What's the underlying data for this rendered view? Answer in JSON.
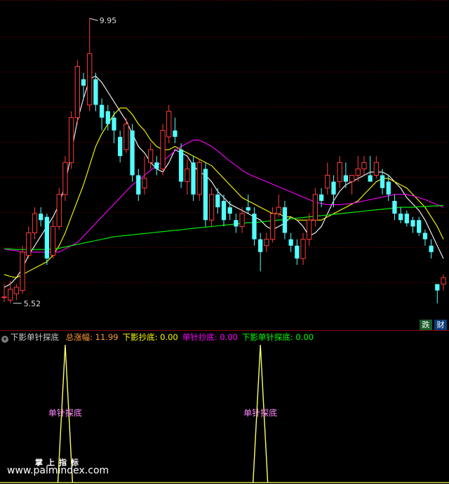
{
  "header": {
    "indicator_name": "下影单针探底",
    "items": [
      {
        "label": "总涨幅:",
        "value": "11.99",
        "color": "#ff9933"
      },
      {
        "label": "下影抄底:",
        "value": "0.00",
        "color": "#ffff00"
      },
      {
        "label": "单针抄底:",
        "value": "0.00",
        "color": "#ff00ff"
      },
      {
        "label": "下影单针探底:",
        "value": "0.00",
        "color": "#00ff00"
      }
    ]
  },
  "tags": {
    "fall": "跌",
    "finance": "财"
  },
  "watermark": {
    "cn": "掌上指标",
    "url": "www.palmindex.com"
  },
  "colors": {
    "up": "#ff3c3c",
    "down": "#54ffff",
    "ma5": "#ffffff",
    "ma10": "#ffff00",
    "ma20": "#ff00ff",
    "ma60": "#00ff00",
    "grid": "#8b0000"
  },
  "chart_data": [
    {
      "type": "candlestick",
      "annotations": {
        "high": "9.95",
        "low": "5.52"
      },
      "ylim": [
        5.3,
        10.15
      ],
      "x_count": 73,
      "candles": [
        [
          5.6,
          5.6,
          5.8,
          5.52
        ],
        [
          5.55,
          5.72,
          5.85,
          5.5
        ],
        [
          5.65,
          5.75,
          5.8,
          5.55
        ],
        [
          5.7,
          6.3,
          6.4,
          5.65
        ],
        [
          6.25,
          6.6,
          6.7,
          6.2
        ],
        [
          6.6,
          6.9,
          7.0,
          6.5
        ],
        [
          6.9,
          6.8,
          7.0,
          6.7
        ],
        [
          6.85,
          6.2,
          6.9,
          6.1
        ],
        [
          6.25,
          6.7,
          6.8,
          6.2
        ],
        [
          6.7,
          7.2,
          7.3,
          6.65
        ],
        [
          7.2,
          7.7,
          7.8,
          7.1
        ],
        [
          7.7,
          8.4,
          8.5,
          7.6
        ],
        [
          8.4,
          9.2,
          9.3,
          8.3
        ],
        [
          9.0,
          8.9,
          9.1,
          8.7
        ],
        [
          8.6,
          9.4,
          9.95,
          8.5
        ],
        [
          9.0,
          8.6,
          9.1,
          8.5
        ],
        [
          8.6,
          8.4,
          8.7,
          8.2
        ],
        [
          8.5,
          8.3,
          8.6,
          8.2
        ],
        [
          8.4,
          8.2,
          8.5,
          8.0
        ],
        [
          8.1,
          7.8,
          8.2,
          7.7
        ],
        [
          7.9,
          8.3,
          8.4,
          7.85
        ],
        [
          8.2,
          7.5,
          8.3,
          7.4
        ],
        [
          7.5,
          7.2,
          7.6,
          7.1
        ],
        [
          7.3,
          7.45,
          7.8,
          7.2
        ],
        [
          7.7,
          7.9,
          8.0,
          7.6
        ],
        [
          7.7,
          7.6,
          7.8,
          7.5
        ],
        [
          7.6,
          8.2,
          8.3,
          7.5
        ],
        [
          8.1,
          8.5,
          8.6,
          8.0
        ],
        [
          8.2,
          8.1,
          8.4,
          8.0
        ],
        [
          7.9,
          7.4,
          8.0,
          7.3
        ],
        [
          7.4,
          7.6,
          7.75,
          7.2
        ],
        [
          7.7,
          7.2,
          7.8,
          7.1
        ],
        [
          7.2,
          7.7,
          7.75,
          7.1
        ],
        [
          7.6,
          6.8,
          7.7,
          6.7
        ],
        [
          6.8,
          7.2,
          7.3,
          6.7
        ],
        [
          7.2,
          7.0,
          7.3,
          6.9
        ],
        [
          7.1,
          6.8,
          7.2,
          6.7
        ],
        [
          7.0,
          6.9,
          7.1,
          6.8
        ],
        [
          6.8,
          6.7,
          6.9,
          6.6
        ],
        [
          6.7,
          6.9,
          7.0,
          6.6
        ],
        [
          7.0,
          6.95,
          7.2,
          6.9
        ],
        [
          6.9,
          6.5,
          7.0,
          6.4
        ],
        [
          6.5,
          6.3,
          6.6,
          6.0
        ],
        [
          6.4,
          6.5,
          6.6,
          6.3
        ],
        [
          6.5,
          6.9,
          7.0,
          6.45
        ],
        [
          6.9,
          7.0,
          7.2,
          6.85
        ],
        [
          7.0,
          6.6,
          7.1,
          6.5
        ],
        [
          6.5,
          6.4,
          6.6,
          6.3
        ],
        [
          6.4,
          6.2,
          6.5,
          6.1
        ],
        [
          6.2,
          6.5,
          6.6,
          6.1
        ],
        [
          6.5,
          6.8,
          6.9,
          6.4
        ],
        [
          6.8,
          7.2,
          7.3,
          6.7
        ],
        [
          7.2,
          7.1,
          7.3,
          7.0
        ],
        [
          7.3,
          7.5,
          7.7,
          7.2
        ],
        [
          7.4,
          7.2,
          7.5,
          7.0
        ],
        [
          7.4,
          7.7,
          7.8,
          7.3
        ],
        [
          7.5,
          7.4,
          7.7,
          7.3
        ],
        [
          7.4,
          7.5,
          7.5,
          7.2
        ],
        [
          7.5,
          7.6,
          7.8,
          7.4
        ],
        [
          7.6,
          7.7,
          7.8,
          7.5
        ],
        [
          7.5,
          7.4,
          7.8,
          7.4
        ],
        [
          7.5,
          7.7,
          7.8,
          7.45
        ],
        [
          7.5,
          7.3,
          7.6,
          7.2
        ],
        [
          7.4,
          7.2,
          7.5,
          7.1
        ],
        [
          7.1,
          6.9,
          7.2,
          6.8
        ],
        [
          6.9,
          6.8,
          7.0,
          6.75
        ],
        [
          6.9,
          6.75,
          6.95,
          6.7
        ],
        [
          6.8,
          6.7,
          6.85,
          6.6
        ],
        [
          6.8,
          6.6,
          6.85,
          6.55
        ],
        [
          6.6,
          6.5,
          6.65,
          6.4
        ],
        [
          6.4,
          6.3,
          6.5,
          6.2
        ],
        [
          5.8,
          5.7,
          5.8,
          5.5
        ],
        [
          5.8,
          5.9,
          5.95,
          5.7
        ]
      ],
      "ma": {
        "ma5": [
          5.75,
          5.8,
          5.9,
          6.05,
          6.25,
          6.4,
          6.55,
          6.7,
          6.85,
          7.05,
          7.35,
          7.85,
          8.35,
          8.7,
          9.0,
          9.05,
          8.95,
          8.8,
          8.65,
          8.5,
          8.35,
          8.15,
          7.95,
          7.85,
          7.7,
          7.6,
          7.55,
          7.7,
          7.9,
          7.85,
          7.8,
          7.65,
          7.55,
          7.5,
          7.4,
          7.25,
          7.15,
          7.05,
          7.0,
          6.95,
          6.9,
          6.85,
          6.8,
          6.7,
          6.65,
          6.7,
          6.75,
          6.85,
          6.8,
          6.7,
          6.55,
          6.6,
          6.7,
          6.9,
          7.1,
          7.25,
          7.35,
          7.4,
          7.45,
          7.5,
          7.55,
          7.55,
          7.55,
          7.5,
          7.4,
          7.3,
          7.15,
          7.05,
          6.95,
          6.8,
          6.6,
          6.4,
          6.2
        ],
        "ma10": [
          5.95,
          5.92,
          5.9,
          5.95,
          6.0,
          6.05,
          6.1,
          6.15,
          6.25,
          6.4,
          6.6,
          6.85,
          7.1,
          7.35,
          7.65,
          7.95,
          8.15,
          8.3,
          8.45,
          8.55,
          8.55,
          8.45,
          8.3,
          8.2,
          8.05,
          7.95,
          7.9,
          7.9,
          7.95,
          7.9,
          7.85,
          7.8,
          7.75,
          7.7,
          7.65,
          7.55,
          7.45,
          7.35,
          7.25,
          7.15,
          7.1,
          7.05,
          7.0,
          6.95,
          6.9,
          6.9,
          6.85,
          6.85,
          6.8,
          6.8,
          6.8,
          6.8,
          6.8,
          6.85,
          6.9,
          6.95,
          7.0,
          7.05,
          7.1,
          7.2,
          7.3,
          7.4,
          7.45,
          7.45,
          7.4,
          7.35,
          7.3,
          7.2,
          7.1,
          7.0,
          6.85,
          6.7,
          6.5
        ],
        "ma20": [
          6.35,
          6.33,
          6.32,
          6.3,
          6.3,
          6.3,
          6.3,
          6.3,
          6.3,
          6.3,
          6.35,
          6.4,
          6.45,
          6.55,
          6.65,
          6.75,
          6.85,
          6.95,
          7.05,
          7.15,
          7.25,
          7.35,
          7.42,
          7.5,
          7.58,
          7.65,
          7.72,
          7.8,
          7.88,
          7.95,
          8.0,
          8.05,
          8.05,
          8.0,
          7.95,
          7.88,
          7.8,
          7.72,
          7.65,
          7.58,
          7.52,
          7.48,
          7.44,
          7.4,
          7.36,
          7.32,
          7.28,
          7.24,
          7.2,
          7.16,
          7.12,
          7.08,
          7.06,
          7.04,
          7.04,
          7.04,
          7.05,
          7.06,
          7.08,
          7.1,
          7.12,
          7.14,
          7.16,
          7.18,
          7.2,
          7.2,
          7.2,
          7.18,
          7.15,
          7.12,
          7.08,
          7.04,
          7.0
        ],
        "ma60": [
          6.35,
          6.35,
          6.34,
          6.34,
          6.34,
          6.34,
          6.34,
          6.34,
          6.35,
          6.36,
          6.38,
          6.4,
          6.42,
          6.44,
          6.46,
          6.48,
          6.5,
          6.52,
          6.54,
          6.55,
          6.56,
          6.57,
          6.58,
          6.59,
          6.6,
          6.61,
          6.62,
          6.63,
          6.64,
          6.65,
          6.66,
          6.67,
          6.68,
          6.69,
          6.7,
          6.71,
          6.72,
          6.73,
          6.74,
          6.75,
          6.76,
          6.76,
          6.77,
          6.78,
          6.79,
          6.8,
          6.81,
          6.82,
          6.83,
          6.84,
          6.85,
          6.86,
          6.87,
          6.88,
          6.89,
          6.9,
          6.91,
          6.92,
          6.93,
          6.94,
          6.95,
          6.96,
          6.97,
          6.98,
          6.99,
          7.0,
          7.0,
          7.0,
          7.01,
          7.01,
          7.02,
          7.02,
          7.03
        ]
      }
    },
    {
      "type": "line",
      "series": [
        {
          "values_at_index": {
            "10": 1,
            "42": 1
          }
        }
      ],
      "labels": [
        {
          "text": "单针探底",
          "x_index": 10
        },
        {
          "text": "单针探底",
          "x_index": 42
        }
      ],
      "ylim": [
        0,
        1
      ]
    }
  ]
}
